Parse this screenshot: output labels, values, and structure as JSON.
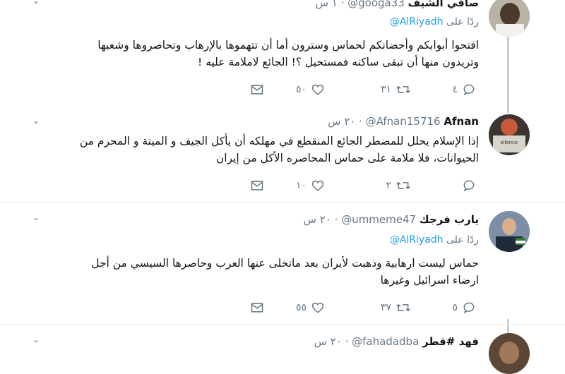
{
  "tweets": [
    {
      "name": "صافي الشيف",
      "handle": "@googa33",
      "time": "١ س",
      "reply_prefix": "ردًا على",
      "reply_to": "@AlRiyadh",
      "lines": [
        "افتحوا أبوابكم وأحضانكم لحماس وسترون أما أن تتهموها بالإرهاب وتحاصروها وشعبها",
        "وتريدون منها أن تبقى ساكنه فمستحيل ؟! الجائع لاملامة عليه !"
      ],
      "replies": "٤",
      "retweets": "٣١",
      "likes": "٥٠"
    },
    {
      "name": "Afnan",
      "handle": "@Afnan15716",
      "time": "٢٠ س",
      "lines": [
        "إذا الإسلام يحلل للمضطر الجائع المنقطع في مهلكه أن يأكل الجيف و الميتة و المحرم من",
        "الحيوانات، فلا ملامة على حماس المحاصره الأكل من إيران"
      ],
      "replies": "",
      "retweets": "٢",
      "likes": "١٠"
    },
    {
      "name": "يارب فرجك",
      "handle": "@ummeme47",
      "time": "٢٠ س",
      "reply_prefix": "ردًا على",
      "reply_to": "@AlRiyadh",
      "lines": [
        "حماس ليست ارهابية وذهبت لأيران بعد ماتخلى عنها العرب وحاصرها السيسي من أجل",
        "ارضاء اسرائيل  وغيرها"
      ],
      "replies": "٥",
      "retweets": "٣٧",
      "likes": "٥٥"
    },
    {
      "name": "فهد #قطر",
      "handle": "@fahadadba",
      "time": "٢٠ س"
    }
  ],
  "colors": {
    "accent": "#1da1f2",
    "muted": "#657786",
    "thread": "#c4cfd6",
    "divider": "#e6ecf0"
  },
  "icons": [
    "reply-icon",
    "retweet-icon",
    "like-icon",
    "dm-icon",
    "chevron-down-icon"
  ]
}
